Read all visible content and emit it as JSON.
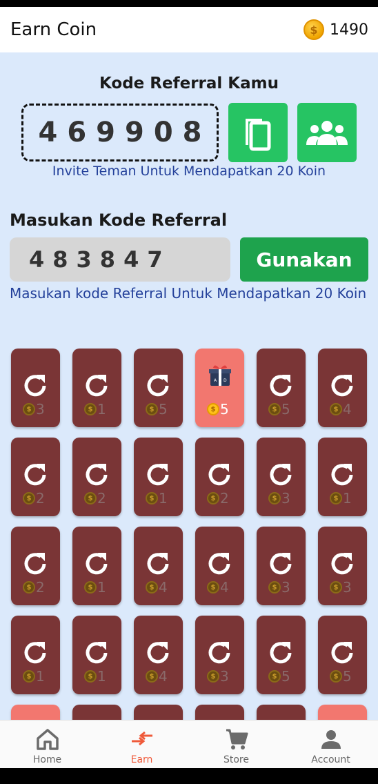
{
  "appbar": {
    "title": "Earn Coin",
    "balance": "1490",
    "coin_symbol": "$"
  },
  "referral": {
    "title": "Kode Referral Kamu",
    "code": "469908",
    "invite_text": "Invite Teman Untuk Mendapatkan 20 Koin",
    "copy_icon": "copy-icon",
    "share_icon": "group-icon"
  },
  "enter_code": {
    "title": "Masukan Kode Referral",
    "value": "483847",
    "button": "Gunakan",
    "note": "Masukan kode Referral Untuk Mendapatkan 20 Koin"
  },
  "cards": [
    {
      "type": "refresh",
      "reward": "3"
    },
    {
      "type": "refresh",
      "reward": "1"
    },
    {
      "type": "refresh",
      "reward": "5"
    },
    {
      "type": "gift",
      "reward": "5"
    },
    {
      "type": "refresh",
      "reward": "5"
    },
    {
      "type": "refresh",
      "reward": "4"
    },
    {
      "type": "refresh",
      "reward": "2"
    },
    {
      "type": "refresh",
      "reward": "2"
    },
    {
      "type": "refresh",
      "reward": "1"
    },
    {
      "type": "refresh",
      "reward": "2"
    },
    {
      "type": "refresh",
      "reward": "3"
    },
    {
      "type": "refresh",
      "reward": "1"
    },
    {
      "type": "refresh",
      "reward": "2"
    },
    {
      "type": "refresh",
      "reward": "1"
    },
    {
      "type": "refresh",
      "reward": "4"
    },
    {
      "type": "refresh",
      "reward": "4"
    },
    {
      "type": "refresh",
      "reward": "3"
    },
    {
      "type": "refresh",
      "reward": "3"
    },
    {
      "type": "refresh",
      "reward": "1"
    },
    {
      "type": "refresh",
      "reward": "1"
    },
    {
      "type": "refresh",
      "reward": "4"
    },
    {
      "type": "refresh",
      "reward": "3"
    },
    {
      "type": "refresh",
      "reward": "5"
    },
    {
      "type": "refresh",
      "reward": "5"
    },
    {
      "type": "gift-partial",
      "reward": ""
    },
    {
      "type": "refresh",
      "reward": ""
    },
    {
      "type": "refresh",
      "reward": ""
    },
    {
      "type": "refresh",
      "reward": ""
    },
    {
      "type": "refresh",
      "reward": ""
    },
    {
      "type": "gift-partial",
      "reward": ""
    }
  ],
  "nav": [
    {
      "label": "Home",
      "icon": "home-icon",
      "active": false
    },
    {
      "label": "Earn",
      "icon": "swap-icon",
      "active": true
    },
    {
      "label": "Store",
      "icon": "cart-icon",
      "active": false
    },
    {
      "label": "Account",
      "icon": "person-icon",
      "active": false
    }
  ],
  "colors": {
    "accent": "#26c463",
    "card": "#7a3536",
    "gift_card": "#f2776f",
    "nav_active": "#ef5a3a",
    "link_text": "#23409a"
  }
}
